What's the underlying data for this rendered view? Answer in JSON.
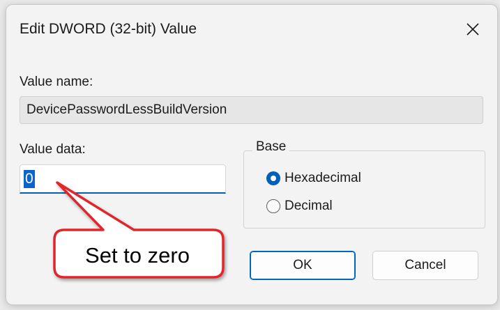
{
  "dialog": {
    "title": "Edit DWORD (32-bit) Value",
    "value_name_label": "Value name:",
    "value_name": "DevicePasswordLessBuildVersion",
    "value_data_label": "Value data:",
    "value_data": "0",
    "base_label": "Base",
    "base_options": [
      {
        "label": "Hexadecimal",
        "checked": true
      },
      {
        "label": "Decimal",
        "checked": false
      }
    ],
    "ok_label": "OK",
    "cancel_label": "Cancel",
    "close_icon": "close-icon"
  },
  "annotation": {
    "text": "Set to zero",
    "color": "#e0262a"
  },
  "colors": {
    "accent": "#005fb8",
    "selection": "#0a64cf"
  }
}
